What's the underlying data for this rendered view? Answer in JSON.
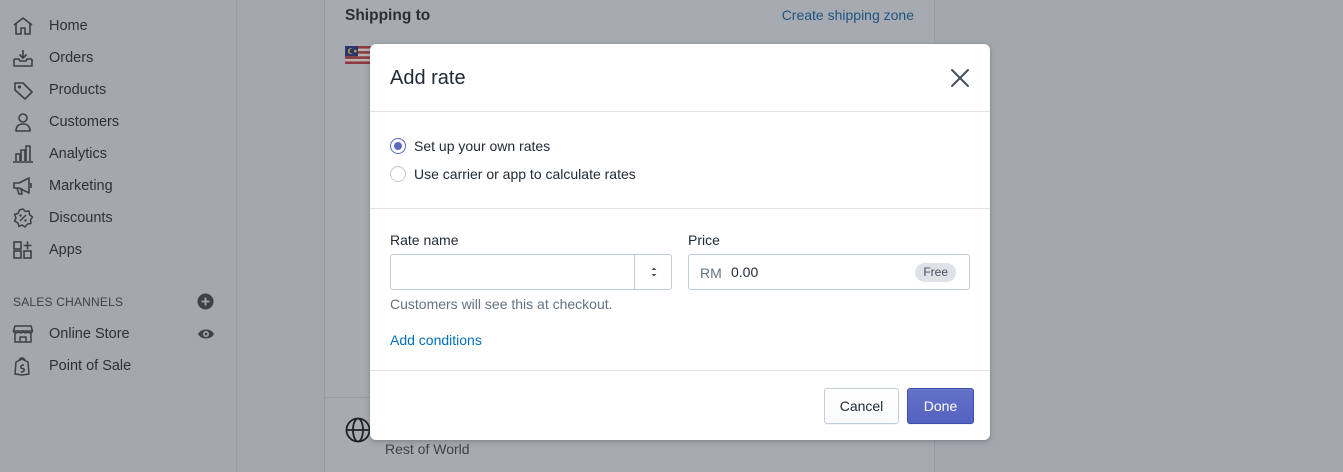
{
  "sidebar": {
    "items": [
      {
        "label": "Home",
        "icon": "home-icon"
      },
      {
        "label": "Orders",
        "icon": "orders-icon"
      },
      {
        "label": "Products",
        "icon": "tag-icon"
      },
      {
        "label": "Customers",
        "icon": "person-icon"
      },
      {
        "label": "Analytics",
        "icon": "bar-chart-icon"
      },
      {
        "label": "Marketing",
        "icon": "megaphone-icon"
      },
      {
        "label": "Discounts",
        "icon": "discount-icon"
      },
      {
        "label": "Apps",
        "icon": "apps-icon"
      }
    ],
    "channels_heading": "SALES CHANNELS",
    "channels": [
      {
        "label": "Online Store",
        "icon": "store-icon"
      },
      {
        "label": "Point of Sale",
        "icon": "pos-bag-icon"
      }
    ]
  },
  "background": {
    "shipping_title": "Shipping to",
    "create_zone_link": "Create shipping zone",
    "rest_of_world": "Rest of World"
  },
  "modal": {
    "title": "Add rate",
    "radio_options": [
      {
        "label": "Set up your own rates",
        "checked": true
      },
      {
        "label": "Use carrier or app to calculate rates",
        "checked": false
      }
    ],
    "rate_name_label": "Rate name",
    "rate_name_value": "",
    "price_label": "Price",
    "price_prefix": "RM",
    "price_value": "0.00",
    "free_badge": "Free",
    "help_text": "Customers will see this at checkout.",
    "add_conditions": "Add conditions",
    "cancel_label": "Cancel",
    "done_label": "Done"
  },
  "colors": {
    "primary": "#5c6ac4",
    "link": "#006fbb",
    "overlay_background": "#a3a7ae"
  }
}
